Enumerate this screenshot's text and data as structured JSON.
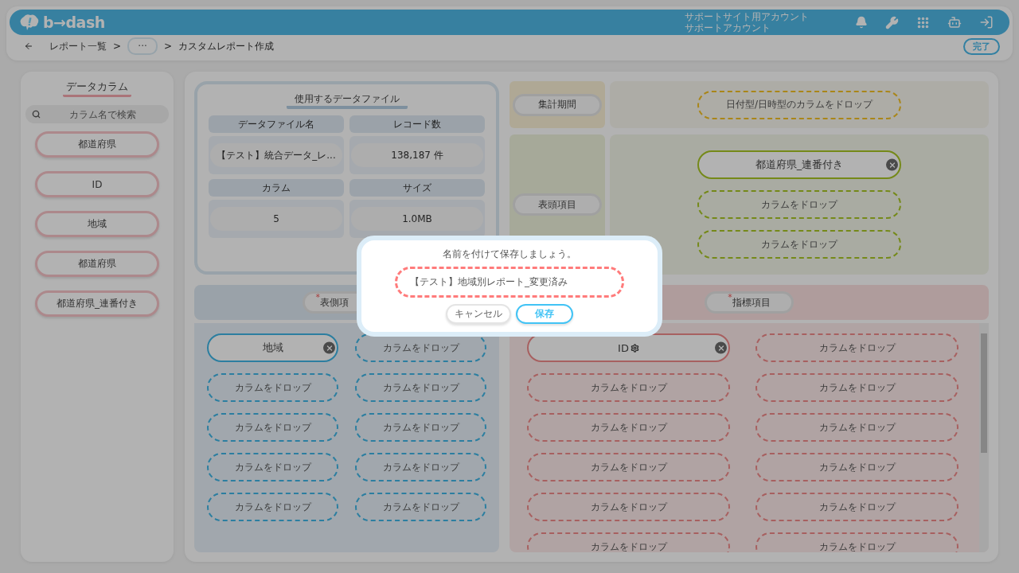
{
  "header": {
    "logo": "b→dash",
    "account": [
      "サポートサイト用アカウント",
      "サポートアカウント"
    ]
  },
  "breadcrumb": {
    "separator": ">",
    "items": [
      {
        "kind": "link",
        "label": "レポート一覧"
      },
      {
        "kind": "more",
        "label": "···"
      },
      {
        "kind": "current",
        "label": "カスタムレポート作成"
      }
    ]
  },
  "done_button": "完了",
  "sidebar": {
    "title": "データカラム",
    "search_placeholder": "カラム名で検索",
    "columns": [
      "都道府県",
      "ID",
      "地域",
      "都道府県",
      "都道府県_連番付き"
    ]
  },
  "data_file": {
    "title": "使用するデータファイル",
    "cells": [
      {
        "label": "データファイル名",
        "value": "【テスト】統合データ_レ..."
      },
      {
        "label": "レコード数",
        "value": "138,187 件"
      },
      {
        "label": "カラム",
        "value": "5"
      },
      {
        "label": "サイズ",
        "value": "1.0MB"
      }
    ]
  },
  "period": {
    "label": "集計期間",
    "slots": [
      {
        "kind": "empty",
        "label": "日付型/日時型のカラムをドロップ"
      }
    ]
  },
  "column_header": {
    "label": "表頭項目",
    "slots": [
      {
        "kind": "filled",
        "label": "都道府県_連番付き"
      },
      {
        "kind": "empty",
        "label": "カラムをドロップ"
      },
      {
        "kind": "empty",
        "label": "カラムをドロップ"
      }
    ]
  },
  "row_header": {
    "label": "表側項",
    "required_mark": "*",
    "slots": [
      {
        "kind": "filled",
        "label": "地域"
      },
      {
        "kind": "empty",
        "label": "カラムをドロップ"
      },
      {
        "kind": "empty",
        "label": "カラムをドロップ"
      },
      {
        "kind": "empty",
        "label": "カラムをドロップ"
      },
      {
        "kind": "empty",
        "label": "カラムをドロップ"
      },
      {
        "kind": "empty",
        "label": "カラムをドロップ"
      },
      {
        "kind": "empty",
        "label": "カラムをドロップ"
      },
      {
        "kind": "empty",
        "label": "カラムをドロップ"
      },
      {
        "kind": "empty",
        "label": "カラムをドロップ"
      },
      {
        "kind": "empty",
        "label": "カラムをドロップ"
      }
    ]
  },
  "metrics": {
    "label": "指標項目",
    "required_mark": "*",
    "slots": [
      {
        "kind": "filled",
        "label": "ID",
        "settings": true
      },
      {
        "kind": "empty",
        "label": "カラムをドロップ"
      },
      {
        "kind": "empty",
        "label": "カラムをドロップ"
      },
      {
        "kind": "empty",
        "label": "カラムをドロップ"
      },
      {
        "kind": "empty",
        "label": "カラムをドロップ"
      },
      {
        "kind": "empty",
        "label": "カラムをドロップ"
      },
      {
        "kind": "empty",
        "label": "カラムをドロップ"
      },
      {
        "kind": "empty",
        "label": "カラムをドロップ"
      },
      {
        "kind": "empty",
        "label": "カラムをドロップ"
      },
      {
        "kind": "empty",
        "label": "カラムをドロップ"
      },
      {
        "kind": "empty",
        "label": "カラムをドロップ"
      },
      {
        "kind": "empty",
        "label": "カラムをドロップ"
      }
    ]
  },
  "modal": {
    "message": "名前を付けて保存しましょう。",
    "value": "【テスト】地域別レポート_変更済み",
    "buttons": [
      {
        "kind": "cancel",
        "label": "キャンセル"
      },
      {
        "kind": "primary",
        "label": "保存"
      }
    ]
  }
}
